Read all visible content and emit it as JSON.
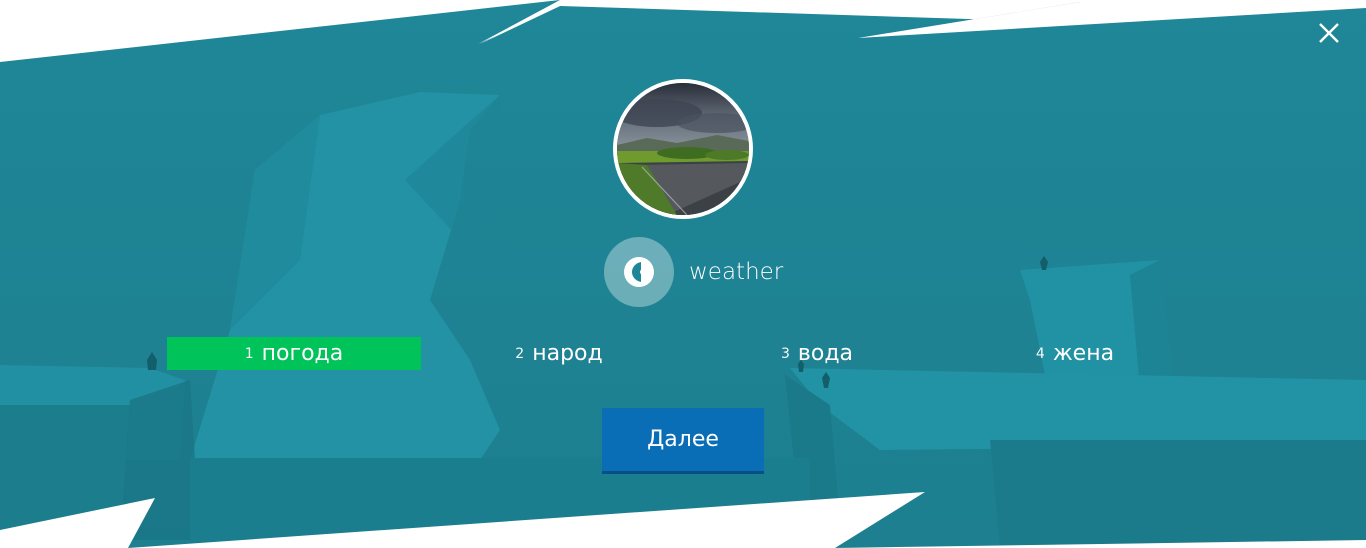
{
  "colors": {
    "background": "#1f8696",
    "selected": "#00c35a",
    "next_button": "#0a6eb7"
  },
  "close": {
    "icon": "close-icon"
  },
  "word_card": {
    "image_icon": "weather-photo",
    "audio_icon": "speaker-icon",
    "word": "weather"
  },
  "options": [
    {
      "num": "1",
      "text": "погода",
      "selected": true
    },
    {
      "num": "2",
      "text": "народ",
      "selected": false
    },
    {
      "num": "3",
      "text": "вода",
      "selected": false
    },
    {
      "num": "4",
      "text": "жена",
      "selected": false
    }
  ],
  "next_button": {
    "label": "Далее"
  }
}
